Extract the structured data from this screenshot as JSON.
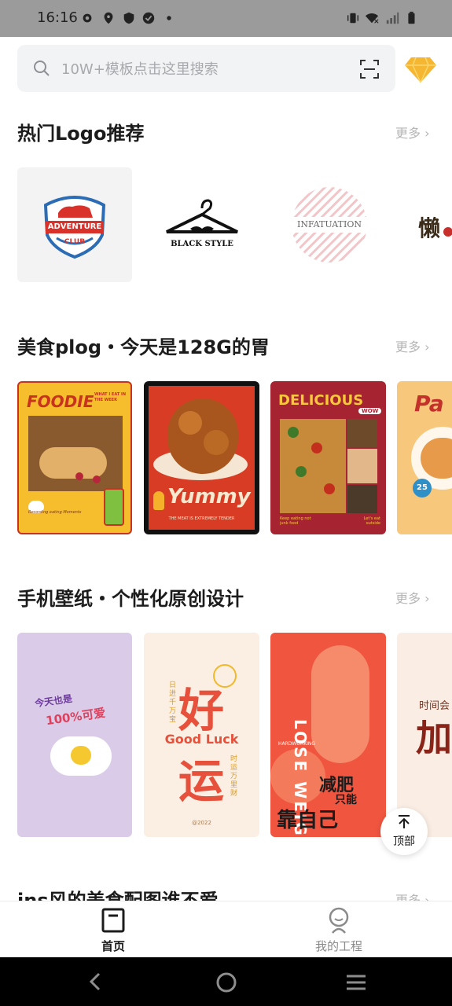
{
  "status_bar": {
    "time": "16:16"
  },
  "search": {
    "placeholder": "10W+模板点击这里搜索"
  },
  "sections": [
    {
      "title": "热门Logo推荐",
      "more": "更多 ›"
    },
    {
      "title": "美食plog・今天是128G的胃",
      "more": "更多 ›"
    },
    {
      "title": "手机壁纸・个性化原创设计",
      "more": "更多 ›"
    },
    {
      "title": "ins风的美食配图谁不爱",
      "more": "更多 ›"
    }
  ],
  "logo_cards": [
    {
      "banner": "ADVENTURE",
      "sub": "CLUB"
    },
    {
      "text": "BLACK STYLE"
    },
    {
      "text": "INFATUATION"
    },
    {
      "text": "懒"
    }
  ],
  "food_cards": [
    {
      "title": "FOODIE",
      "tag": "WHAT I EAT IN THE WEEK",
      "caption": "Recording eating Moments"
    },
    {
      "title": "Yummy",
      "caption": "THE MEAT IS EXTREMELY TENDER"
    },
    {
      "title": "DELICIOUS",
      "badge": "WOW",
      "left_note": "Keep eating not junk food",
      "right_note": "Let's eat outside"
    },
    {
      "title": "Pa",
      "badge": "25"
    }
  ],
  "wallpaper_cards": [
    {
      "line1": "今天也是",
      "line2": "100%可爱"
    },
    {
      "big1": "好",
      "big2": "运",
      "en": "Good Luck",
      "side_left": "日进千万宝",
      "side_right": "时运万里财",
      "year": "@2022"
    },
    {
      "vertical": "LOSE WEIGHT",
      "small": "HARDWORKING",
      "cn1": "减肥",
      "cn2": "只能",
      "cn3": "靠自己"
    },
    {
      "small": "时间会",
      "big": "加"
    }
  ],
  "top_button": {
    "label": "顶部"
  },
  "bottom_nav": [
    {
      "label": "首页",
      "active": true
    },
    {
      "label": "我的工程",
      "active": false
    }
  ]
}
